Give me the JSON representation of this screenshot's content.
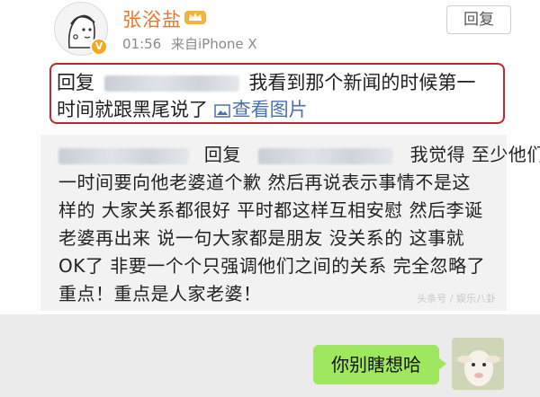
{
  "header": {
    "username": "张浴盐",
    "time": "01:56",
    "source": "来自iPhone X",
    "reply_button": "回复"
  },
  "highlighted_reply": {
    "prefix": "回复",
    "text_1": "我看到那个新闻的时候第一",
    "text_2": "时间就跟黑尾说了",
    "view_image": "查看图片"
  },
  "comment": {
    "line1_prefix": "回复",
    "line1_text": "我觉得 至少他们第",
    "line2": "一时间要向他老婆道个歉 然后再说表示事情不是这",
    "line3": "样的 大家关系都很好 平时都这样互相安慰 然后李诞",
    "line4": "老婆再出来 说一句大家都是朋友 没关系的 这事就",
    "line5": "OK了 非要一个个只强调他们之间的关系 完全忽略了",
    "line6": "重点！重点是人家老婆！",
    "watermark": "头条号 / 娱乐八卦"
  },
  "chat": {
    "bubble_text": "你别瞎想哈"
  },
  "colors": {
    "username": "#e8762c",
    "highlight_border": "#c0262d",
    "link": "#4a72a8",
    "bubble": "#9fe75f"
  }
}
